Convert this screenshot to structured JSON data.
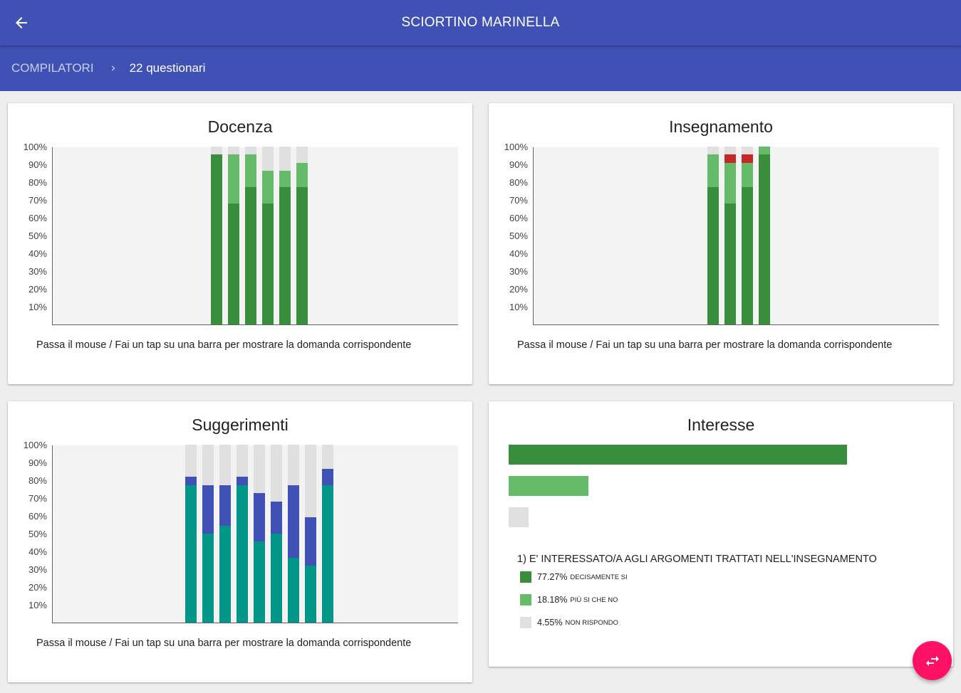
{
  "header": {
    "title": "SCIORTINO MARINELLA"
  },
  "breadcrumb": {
    "root": "COMPILATORI",
    "current": "22 questionari"
  },
  "yticks": [
    "100%",
    "90%",
    "80%",
    "70%",
    "60%",
    "50%",
    "40%",
    "30%",
    "20%",
    "10%"
  ],
  "hint_text": "Passa il mouse / Fai un tap su una barra per mostrare la domanda corrispondente",
  "colors": {
    "dark_green": "#388e3c",
    "light_green": "#66bb6a",
    "grey": "#e0e0e0",
    "red": "#c62828",
    "teal": "#009688",
    "indigo": "#3f51b5",
    "fab": "#ff1166"
  },
  "chart_data": [
    {
      "type": "bar",
      "stacked": true,
      "title": "Docenza",
      "ylim": [
        0,
        100
      ],
      "y_unit": "%",
      "series": [
        {
          "color": "#388e3c",
          "values": [
            95.45,
            68.18,
            77.27,
            68.18,
            77.27,
            77.27
          ]
        },
        {
          "color": "#66bb6a",
          "values": [
            0,
            27.27,
            18.18,
            18.18,
            9.09,
            13.64
          ]
        },
        {
          "color": "#e0e0e0",
          "values": [
            4.55,
            4.55,
            4.55,
            13.64,
            13.64,
            9.09
          ]
        }
      ]
    },
    {
      "type": "bar",
      "stacked": true,
      "title": "Insegnamento",
      "ylim": [
        0,
        100
      ],
      "y_unit": "%",
      "series": [
        {
          "color": "#388e3c",
          "values": [
            77.27,
            68.18,
            77.27,
            95.45
          ]
        },
        {
          "color": "#66bb6a",
          "values": [
            18.18,
            22.73,
            13.64,
            4.55
          ]
        },
        {
          "color": "#c62828",
          "values": [
            0,
            4.55,
            4.55,
            0
          ]
        },
        {
          "color": "#e0e0e0",
          "values": [
            4.55,
            4.55,
            4.55,
            0
          ]
        }
      ]
    },
    {
      "type": "bar",
      "stacked": true,
      "title": "Suggerimenti",
      "ylim": [
        0,
        100
      ],
      "y_unit": "%",
      "series": [
        {
          "color": "#009688",
          "values": [
            77.27,
            50,
            54.55,
            77.27,
            45.45,
            50,
            36.36,
            31.82,
            77.27
          ]
        },
        {
          "color": "#3f51b5",
          "values": [
            4.55,
            27.27,
            22.73,
            4.55,
            27.27,
            18.18,
            40.91,
            27.27,
            9.09
          ]
        },
        {
          "color": "#e0e0e0",
          "values": [
            18.18,
            22.73,
            22.73,
            18.18,
            27.27,
            31.82,
            22.73,
            40.91,
            13.64
          ]
        }
      ]
    },
    {
      "type": "bar",
      "orientation": "horizontal",
      "title": "Interesse",
      "question": "1) E' INTERESSATO/A AGLI ARGOMENTI TRATTATI NELL'INSEGNAMENTO",
      "items": [
        {
          "value": 77.27,
          "pct": "77.27%",
          "label": "DECISAMENTE SI",
          "color": "#388e3c"
        },
        {
          "value": 18.18,
          "pct": "18.18%",
          "label": "PIÙ SI CHE NO",
          "color": "#66bb6a"
        },
        {
          "value": 4.55,
          "pct": "4.55%",
          "label": "NON RISPONDO",
          "color": "#e0e0e0"
        }
      ]
    }
  ]
}
